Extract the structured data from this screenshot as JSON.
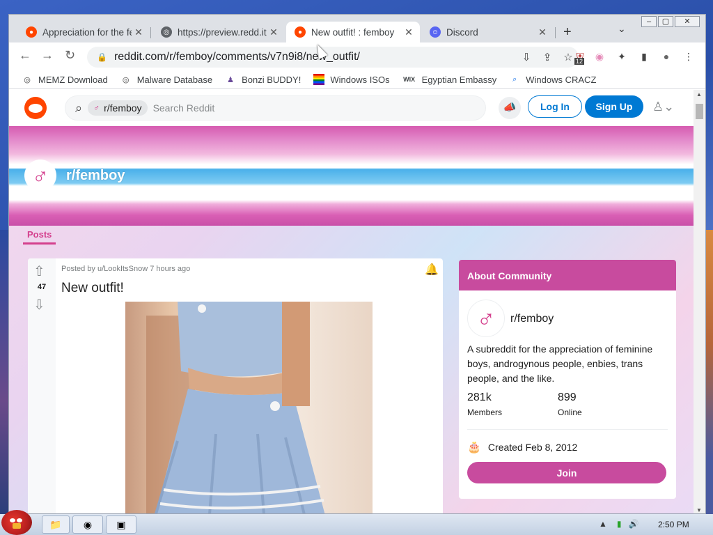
{
  "browser": {
    "tabs": [
      {
        "title": "Appreciation for the fe",
        "favicon": "reddit-icon",
        "color": "#ff4500"
      },
      {
        "title": "https://preview.redd.it",
        "favicon": "globe-icon",
        "color": "#5f6368"
      },
      {
        "title": "New outfit! : femboy",
        "favicon": "reddit-icon",
        "color": "#ff4500",
        "active": true
      },
      {
        "title": "Discord",
        "favicon": "discord-icon",
        "color": "#5865f2"
      }
    ],
    "new_tab": "+",
    "url": "reddit.com/r/femboy/comments/v7n9i8/new_outfit/",
    "extension_badge": "12",
    "bookmarks": [
      {
        "label": "MEMZ Download",
        "icon": "globe-icon"
      },
      {
        "label": "Malware Database",
        "icon": "globe-icon"
      },
      {
        "label": "Bonzi BUDDY!",
        "icon": "bonzi-icon"
      },
      {
        "label": "Windows ISOs",
        "icon": "rainbow-flag-icon"
      },
      {
        "label": "Egyptian Embassy",
        "icon": "wix-icon",
        "glyph": "WIX"
      },
      {
        "label": "Windows CRACZ",
        "icon": "search-icon"
      }
    ]
  },
  "reddit": {
    "search": {
      "chip": "r/femboy",
      "placeholder": "Search Reddit"
    },
    "login": "Log In",
    "signup": "Sign Up",
    "subreddit": "r/femboy",
    "tabs": {
      "posts": "Posts"
    },
    "post": {
      "score": "47",
      "meta": "Posted by u/LookItsSnow 7 hours ago",
      "title": "New outfit!"
    },
    "about": {
      "header": "About Community",
      "name": "r/femboy",
      "description": "A subreddit for the appreciation of feminine boys, androgynous people, enbies, trans people, and the like.",
      "members_value": "281k",
      "members_label": "Members",
      "online_value": "899",
      "online_label": "Online",
      "created": "Created Feb 8, 2012",
      "join": "Join"
    },
    "colors": {
      "brand": "#ff4500",
      "accent": "#c84b9e",
      "blue": "#0079d3"
    }
  },
  "taskbar": {
    "clock": "2:50 PM"
  }
}
